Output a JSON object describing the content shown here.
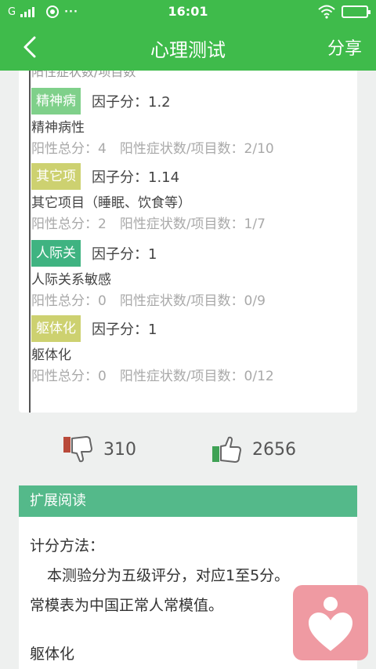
{
  "status": {
    "carrier": "G",
    "time": "16:01",
    "more": "···"
  },
  "navbar": {
    "title": "心理测试",
    "share": "分享"
  },
  "card": {
    "clipped_text": "阳性症状数/项目数",
    "factors": [
      {
        "tag": "精神病",
        "score": "因子分：1.2",
        "name": "精神病性",
        "stat": "阳性总分：4　阳性症状数/项目数：2/10"
      },
      {
        "tag": "其它项",
        "score": "因子分：1.14",
        "name": "其它项目（睡眠、饮食等）",
        "stat": "阳性总分：2　阳性症状数/项目数：1/7"
      },
      {
        "tag": "人际关",
        "score": "因子分：1",
        "name": "人际关系敏感",
        "stat": "阳性总分：0　阳性症状数/项目数：0/9"
      },
      {
        "tag": "躯体化",
        "score": "因子分：1",
        "name": "躯体化",
        "stat": "阳性总分：0　阳性症状数/项目数：0/12"
      }
    ]
  },
  "votes": {
    "dislike": "310",
    "like": "2656"
  },
  "extended": {
    "title": "扩展阅读",
    "heading": "计分方法：",
    "para1": "本测验分为五级评分，对应1至5分。",
    "para2": "常模表为中国正常人常模值。",
    "para3": "躯体化"
  },
  "colors": {
    "brand": "#3fbb4b",
    "section_header": "#54b98a",
    "fab": "#ef9aa2"
  }
}
